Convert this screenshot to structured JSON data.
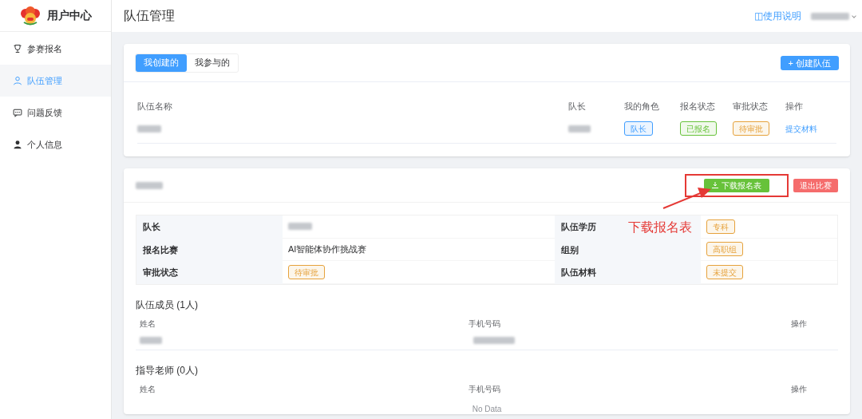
{
  "sidebar": {
    "title": "用户中心",
    "items": [
      {
        "label": "参赛报名",
        "selected": false
      },
      {
        "label": "队伍管理",
        "selected": true
      },
      {
        "label": "问题反馈",
        "selected": false
      },
      {
        "label": "个人信息",
        "selected": false
      }
    ]
  },
  "header": {
    "title": "队伍管理",
    "help_link": "◫使用说明",
    "user": {
      "kind": "redacted"
    }
  },
  "teams_card": {
    "tabs": [
      {
        "label": "我创建的",
        "selected": true
      },
      {
        "label": "我参与的",
        "selected": false
      }
    ],
    "create_button": "+ 创建队伍",
    "columns": [
      "队伍名称",
      "队长",
      "我的角色",
      "报名状态",
      "审批状态",
      "操作"
    ],
    "rows": [
      {
        "cells": [
          {
            "kind": "redacted"
          },
          {
            "kind": "redacted"
          },
          {
            "kind": "tag",
            "text": "队长",
            "color": "#409eff"
          },
          {
            "kind": "tag",
            "text": "已报名",
            "color": "#67c23a"
          },
          {
            "kind": "tag",
            "text": "待审批",
            "color": "#e6a23c"
          },
          {
            "kind": "link",
            "text": "提交材料"
          }
        ]
      }
    ]
  },
  "team_detail": {
    "name": {
      "kind": "redacted"
    },
    "download_button": "下载报名表",
    "quit_button": "退出比赛",
    "info": [
      {
        "label": "队长",
        "value": {
          "kind": "redacted"
        }
      },
      {
        "label": "队伍学历",
        "value": {
          "kind": "tag",
          "text": "专科",
          "color": "#e6a23c"
        }
      },
      {
        "label": "报名比赛",
        "value": {
          "kind": "text",
          "text": "AI智能体协作挑战赛"
        }
      },
      {
        "label": "组别",
        "value": {
          "kind": "tag",
          "text": "高职组",
          "color": "#e6a23c"
        }
      },
      {
        "label": "审批状态",
        "value": {
          "kind": "tag",
          "text": "待审批",
          "color": "#e6a23c"
        }
      },
      {
        "label": "队伍材料",
        "value": {
          "kind": "tag",
          "text": "未提交",
          "color": "#e6a23c"
        }
      }
    ],
    "sections": [
      {
        "title": "队伍成员 (1人)",
        "columns": [
          "姓名",
          "手机号码",
          "操作"
        ],
        "rows": [
          {
            "cells": [
              {
                "kind": "redacted"
              },
              {
                "kind": "redacted"
              }
            ]
          }
        ]
      },
      {
        "title": "指导老师 (0人)",
        "columns": [
          "姓名",
          "手机号码",
          "操作"
        ],
        "empty_text": "No Data"
      }
    ],
    "annotation": "下载报名表"
  }
}
